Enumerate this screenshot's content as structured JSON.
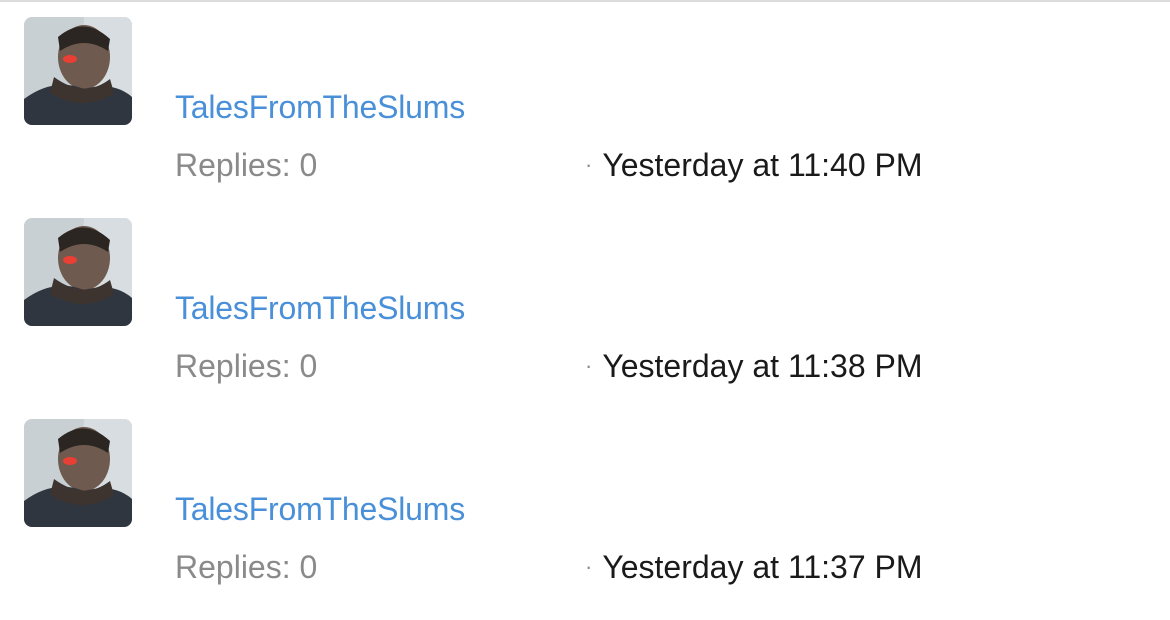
{
  "threads": [
    {
      "avatar_icon": "user-avatar-photo",
      "username": "TalesFromTheSlums",
      "replies": "Replies: 0",
      "separator": "·",
      "time": "Yesterday at 11:40 PM"
    },
    {
      "avatar_icon": "user-avatar-photo",
      "username": "TalesFromTheSlums",
      "replies": "Replies: 0",
      "separator": "·",
      "time": "Yesterday at 11:38 PM"
    },
    {
      "avatar_icon": "user-avatar-photo",
      "username": "TalesFromTheSlums",
      "replies": "Replies: 0",
      "separator": "·",
      "time": "Yesterday at 11:37 PM"
    }
  ],
  "colors": {
    "username_link": "#4a90d9",
    "secondary_text": "#8a8a8a",
    "primary_text": "#1a1a1a"
  }
}
